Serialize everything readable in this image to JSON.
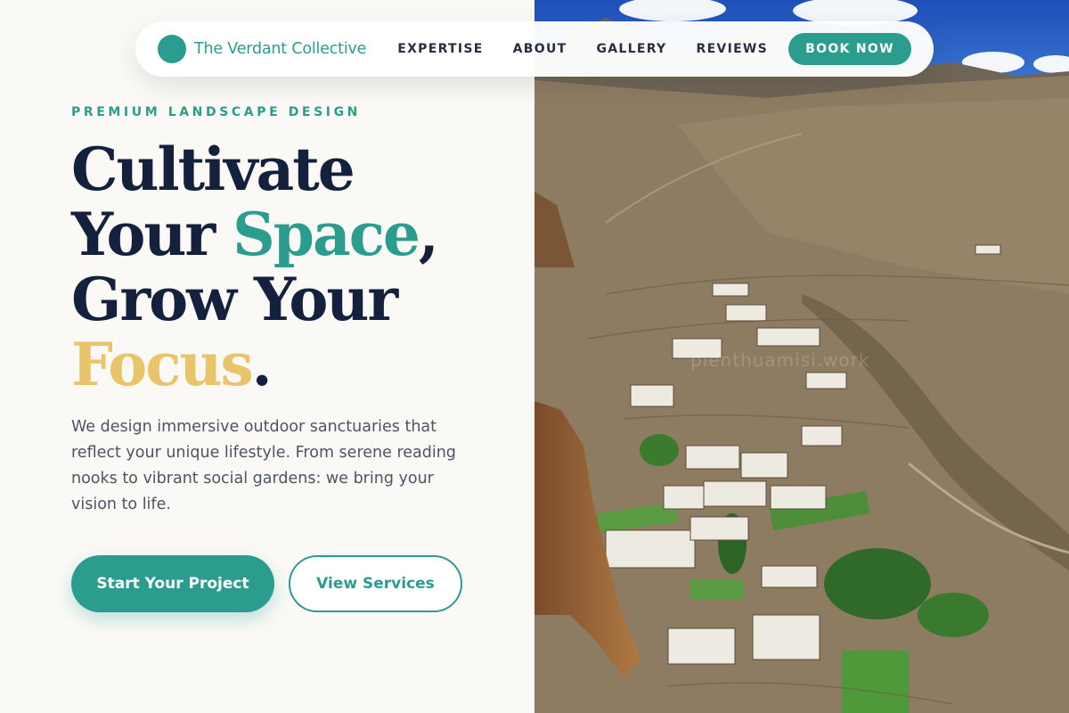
{
  "nav": {
    "brand": "The Verdant Collective",
    "links": [
      "EXPERTISE",
      "ABOUT",
      "GALLERY",
      "REVIEWS"
    ],
    "cta": "BOOK NOW"
  },
  "hero": {
    "eyebrow": "PREMIUM LANDSCAPE DESIGN",
    "headline": {
      "line1": "Cultivate",
      "line2_a": "Your ",
      "line2_b": "Space",
      "line2_c": ",",
      "line3": "Grow Your",
      "line4_a": "Focus",
      "line4_b": "."
    },
    "description": "We design immersive outdoor sanctuaries that reflect your unique lifestyle. From serene reading nooks to vibrant social gardens: we bring your vision to life.",
    "primary_button": "Start Your Project",
    "secondary_button": "View Services"
  },
  "photo": {
    "watermark": "plenthuamisi.work"
  },
  "colors": {
    "accent": "#2A9D8F",
    "gold": "#E9C46A",
    "navy": "#14213D",
    "background": "#FAF9F6"
  }
}
